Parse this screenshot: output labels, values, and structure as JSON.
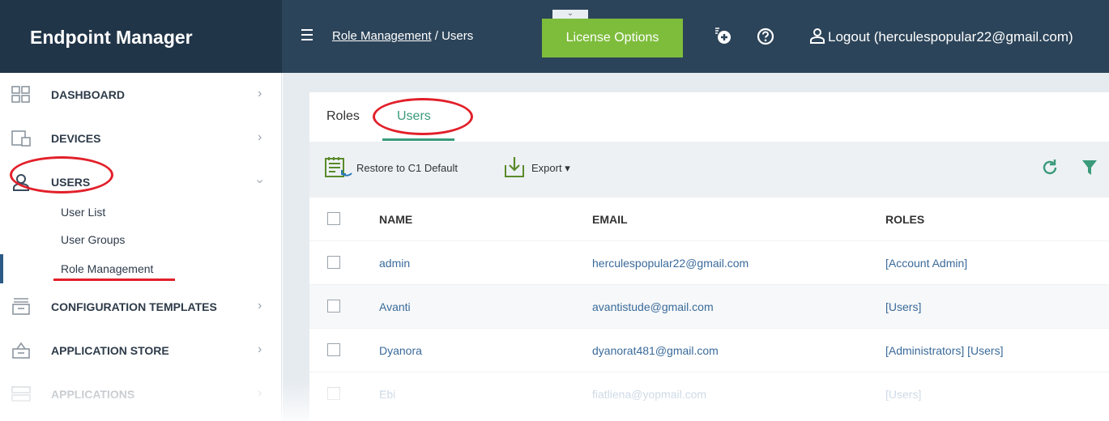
{
  "app": {
    "title": "Endpoint Manager"
  },
  "header": {
    "breadcrumb_link": "Role Management",
    "breadcrumb_separator": " / ",
    "breadcrumb_current": "Users",
    "license_button": "License Options",
    "logout_label": "Logout (herculespopular22@gmail.com)",
    "collapse_glyph": "⌄",
    "icons": [
      "add-notification-icon",
      "help-icon",
      "user-icon",
      "menu-icon"
    ]
  },
  "sidebar": {
    "items": [
      {
        "label": "DASHBOARD",
        "icon": "dashboard-icon"
      },
      {
        "label": "DEVICES",
        "icon": "devices-icon"
      },
      {
        "label": "USERS",
        "icon": "user-icon",
        "expanded": true
      },
      {
        "label": "CONFIGURATION TEMPLATES",
        "icon": "templates-icon"
      },
      {
        "label": "APPLICATION STORE",
        "icon": "store-icon"
      },
      {
        "label": "APPLICATIONS",
        "icon": "applications-icon"
      }
    ],
    "sub_items": [
      {
        "label": "User List"
      },
      {
        "label": "User Groups"
      },
      {
        "label": "Role Management",
        "active": true
      }
    ]
  },
  "tabs": [
    {
      "label": "Roles"
    },
    {
      "label": "Users",
      "active": true
    }
  ],
  "toolbar": {
    "restore_label": "Restore to C1 Default",
    "export_label": "Export",
    "export_caret": "▾",
    "icons": [
      "restore-icon",
      "export-icon",
      "refresh-icon",
      "filter-icon"
    ]
  },
  "table": {
    "columns": [
      "NAME",
      "EMAIL",
      "ROLES"
    ],
    "rows": [
      {
        "name": "admin",
        "email": "herculespopular22@gmail.com",
        "roles": "[Account Admin]"
      },
      {
        "name": "Avanti",
        "email": "avantistude@gmail.com",
        "roles": "[Users]"
      },
      {
        "name": "Dyanora",
        "email": "dyanorat481@gmail.com",
        "roles": "[Administrators] [Users]"
      },
      {
        "name": "Ebi",
        "email": "fiatliena@yopmail.com",
        "roles": "[Users]"
      }
    ]
  },
  "colors": {
    "header_bg": "#2c4459",
    "brand_bg": "#213548",
    "license_button": "#7ebd3c",
    "accent_tab": "#3a9a7a",
    "annotation": "#e2202a",
    "link": "#3a6a9a"
  }
}
